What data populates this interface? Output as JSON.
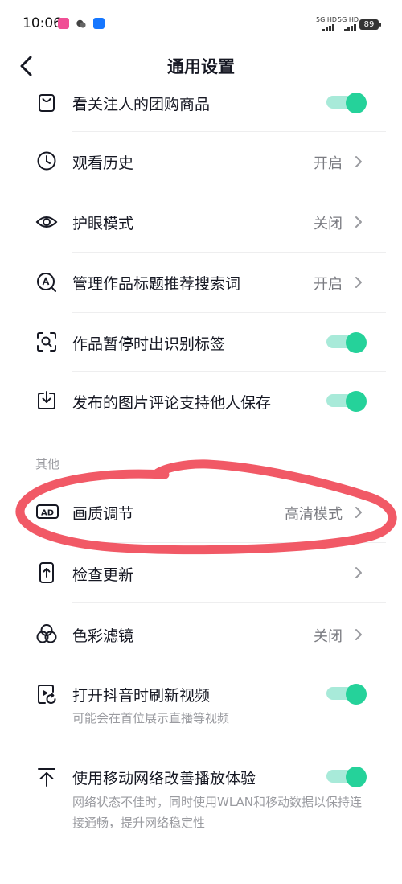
{
  "status_bar": {
    "time": "10:06",
    "net1": "5G HD",
    "net2": "5G HD",
    "battery": "89"
  },
  "header": {
    "title": "通用设置"
  },
  "rows": [
    {
      "label": "看关注人的团购商品",
      "control": "toggle",
      "on": true
    },
    {
      "label": "观看历史",
      "value": "开启"
    },
    {
      "label": "护眼模式",
      "value": "关闭"
    },
    {
      "label": "管理作品标题推荐搜索词",
      "value": "开启"
    },
    {
      "label": "作品暂停时出识别标签",
      "control": "toggle",
      "on": true
    },
    {
      "label": "发布的图片评论支持他人保存",
      "control": "toggle",
      "on": true
    }
  ],
  "section_other": {
    "title": "其他",
    "rows": [
      {
        "label": "画质调节",
        "value": "高清模式"
      },
      {
        "label": "检查更新"
      },
      {
        "label": "色彩滤镜",
        "value": "关闭"
      },
      {
        "label": "打开抖音时刷新视频",
        "control": "toggle",
        "on": true,
        "sub": "可能会在首位展示直播等视频"
      },
      {
        "label": "使用移动网络改善播放体验",
        "control": "toggle",
        "on": true,
        "sub": "网络状态不佳时，同时使用WLAN和移动数据以保持连接通畅，提升网络稳定性"
      }
    ]
  },
  "colors": {
    "toggle_on": "#25d29a",
    "annotation": "#f0505e",
    "wechat": "#2aae67",
    "alipay": "#1677ff"
  },
  "icons": {
    "back": "chevron-left-icon",
    "shopping-bag": "shopping-bag-icon",
    "clock": "clock-icon",
    "eye": "eye-icon",
    "search-a": "search-icon",
    "scan": "scan-icon",
    "download": "download-icon",
    "ad": "ad-icon",
    "phone-update": "phone-update-icon",
    "color-filter": "color-filter-icon",
    "refresh-video": "refresh-video-icon",
    "upload": "upload-icon"
  }
}
